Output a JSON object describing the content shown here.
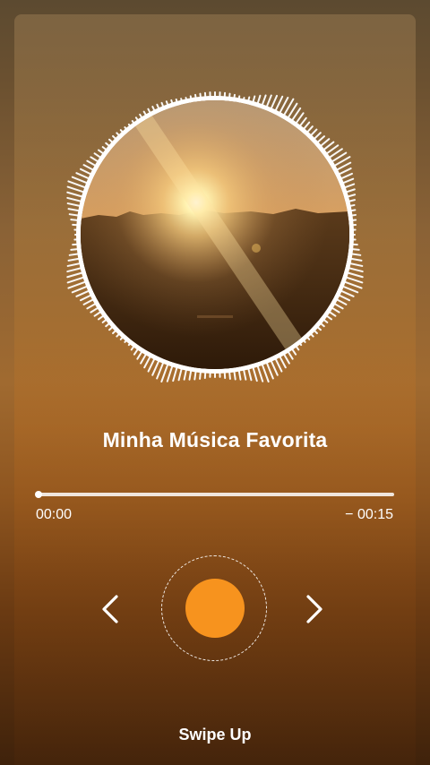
{
  "player": {
    "track_title": "Minha Música Favorita",
    "elapsed": "00:00",
    "remaining": "− 00:15",
    "progress_fraction": 0.0,
    "accent_color": "#f7931e",
    "swipe_hint": "Swipe Up"
  },
  "icons": {
    "previous": "chevron-left-icon",
    "next": "chevron-right-icon"
  }
}
